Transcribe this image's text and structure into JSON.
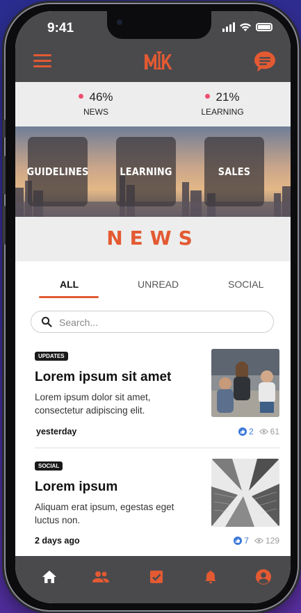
{
  "status": {
    "time": "9:41"
  },
  "stats": [
    {
      "pct": "46%",
      "label": "NEWS"
    },
    {
      "pct": "21%",
      "label": "LEARNING"
    }
  ],
  "categories": [
    "GUIDELINES",
    "LEARNING",
    "SALES"
  ],
  "section_title": "NEWS",
  "tabs": [
    "ALL",
    "UNREAD",
    "SOCIAL"
  ],
  "search": {
    "placeholder": "Search..."
  },
  "articles": [
    {
      "badge": "UPDATES",
      "title": "Lorem ipsum sit amet",
      "text": "Lorem ipsum dolor sit amet, consectetur adipiscing elit.",
      "date": "yesterday",
      "likes": "2",
      "views": "61"
    },
    {
      "badge": "SOCIAL",
      "title": "Lorem ipsum",
      "text": "Aliquam erat ipsum, egestas eget luctus non.",
      "date": "2 days ago",
      "likes": "7",
      "views": "129"
    }
  ],
  "colors": {
    "accent": "#e35a32",
    "header": "#4a4a4d",
    "dot": "#f04e70",
    "like": "#3c78d8"
  },
  "nav": [
    "home-icon",
    "people-icon",
    "checkbox-icon",
    "bell-icon",
    "account-icon"
  ]
}
